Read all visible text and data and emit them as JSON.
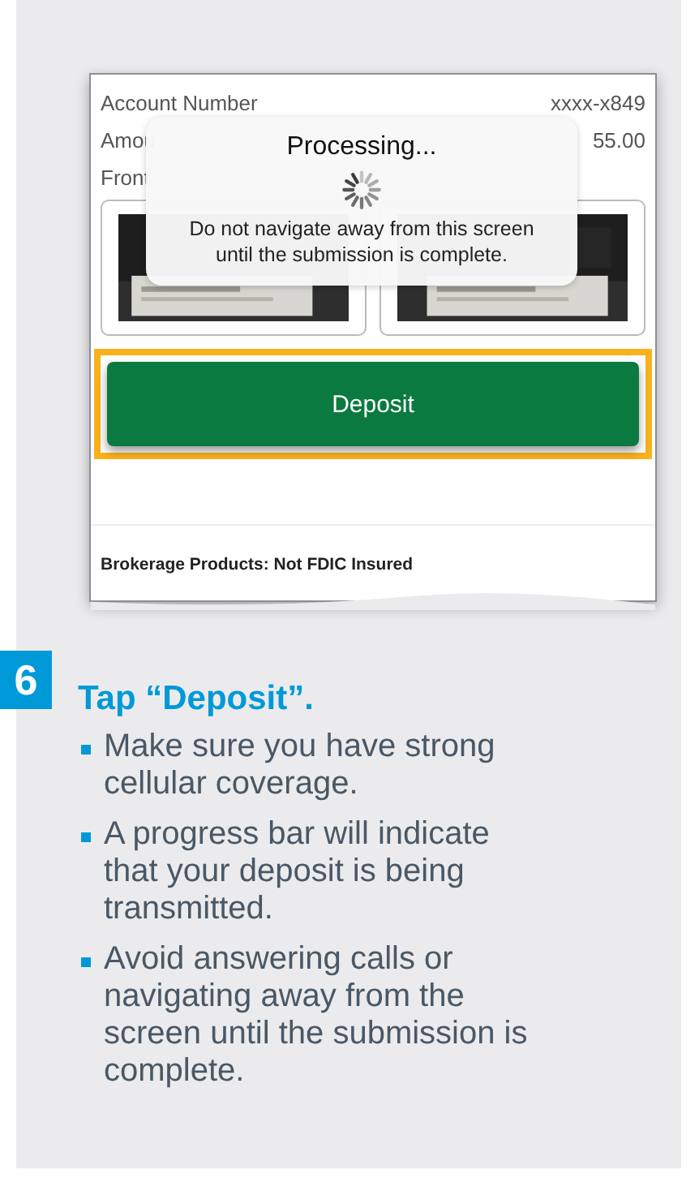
{
  "screen": {
    "account_label": "Account Number",
    "account_value": "xxxx-x849",
    "amount_label": "Amou",
    "amount_value": "55.00",
    "front_label": "Front",
    "overlay": {
      "title": "Processing...",
      "message": "Do not navigate away from this screen until the submission is complete."
    },
    "deposit_button": {
      "label": "Deposit",
      "highlighted": true
    },
    "footer": "Brokerage Products: Not FDIC Insured"
  },
  "step": {
    "number": "6",
    "title": "Tap “Deposit”.",
    "bullets": [
      "Make sure you have strong cellular coverage.",
      "A progress bar will indicate that your deposit is being transmitted.",
      "Avoid answering calls or navigating away from the screen until the submission is complete."
    ]
  }
}
